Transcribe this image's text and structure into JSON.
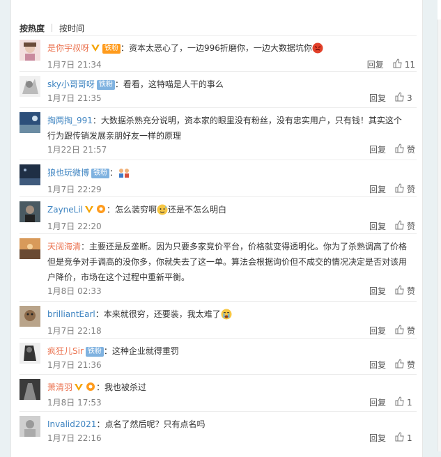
{
  "sort_tabs": [
    "按热度",
    "按时间"
  ],
  "reply_label": "回复",
  "comments": [
    {
      "user": "是你宇叔呀",
      "badges": [
        "vip",
        "gold"
      ],
      "gold_label": "铁粉",
      "text": "：资本太恶心了，一边996折磨你，一边大数据坑你",
      "time": "1月7日 21:34",
      "likes": "11",
      "emoji": "angry-face"
    },
    {
      "user": "sky小哥哥呀",
      "badges": [
        "fan"
      ],
      "fan_label": "铁粉",
      "text": "：看看，这特喵是人干的事么",
      "time": "1月7日 21:35",
      "likes": "3"
    },
    {
      "user": "掏两掏_991",
      "badges": [],
      "text": "：大数据杀熟充分说明，资本家的眼里没有粉丝，没有忠实用户，只有钱！其实这个行为跟传销发展亲朋好友一样的原理",
      "time": "1月22日 21:57",
      "likes": "赞"
    },
    {
      "user": "狼也玩微博",
      "badges": [
        "fan"
      ],
      "fan_label": "铁粉",
      "text": "：",
      "time": "1月7日 22:29",
      "likes": "赞",
      "emoji": "people-icon"
    },
    {
      "user": "ZayneLil",
      "badges": [
        "vip",
        "gold-small"
      ],
      "text": "：怎么装穷啊",
      "text2": "还是不怎么明白",
      "time": "1月7日 22:20",
      "likes": "赞",
      "emoji": "sweat-face"
    },
    {
      "user": "天阔海清",
      "badges": [],
      "text": "：主要还是反垄断。因为只要多家竞价平台，价格就变得透明化。你为了杀熟调高了价格但是竞争对手调高的没你多，你就失去了这一单。算法会根据询价但不成交的情况决定是否对该用户降价，市场在这个过程中重新平衡。",
      "time": "1月8日 02:33",
      "likes": "赞"
    },
    {
      "user": "brilliantEarl",
      "badges": [],
      "text": "：本来就很穷，还要装，我太难了",
      "time": "1月7日 22:18",
      "likes": "赞",
      "emoji": "cry-face"
    },
    {
      "user": "疯狂儿Sir",
      "badges": [
        "fan"
      ],
      "fan_label": "铁粉",
      "text": "：这种企业就得重罚",
      "time": "1月7日 21:36",
      "likes": "赞"
    },
    {
      "user": "萧清羽",
      "badges": [
        "vip",
        "gold-small"
      ],
      "text": "：我也被杀过",
      "time": "1月8日 17:53",
      "likes": "1"
    },
    {
      "user": "Invalid2021",
      "badges": [],
      "text": "：点名了然后呢？只有点名吗",
      "time": "1月7日 22:16",
      "likes": "1"
    }
  ],
  "colors": {
    "username_orange": "#eb7350",
    "username_blue": "#3e84c1",
    "fan_badge": "#7fb2e0",
    "gold_badge": "#ff9b1c"
  }
}
